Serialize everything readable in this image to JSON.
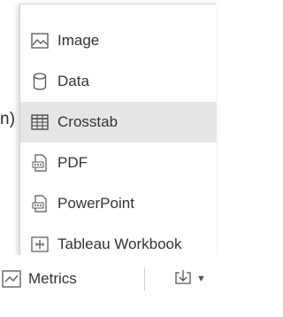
{
  "background_fragment": "n)",
  "download_menu": {
    "items": [
      {
        "label": "Image",
        "icon": "image-icon"
      },
      {
        "label": "Data",
        "icon": "database-icon"
      },
      {
        "label": "Crosstab",
        "icon": "table-grid-icon"
      },
      {
        "label": "PDF",
        "icon": "pdf-file-icon"
      },
      {
        "label": "PowerPoint",
        "icon": "ppt-file-icon"
      },
      {
        "label": "Tableau Workbook",
        "icon": "workbook-file-icon"
      }
    ],
    "highlighted_index": 2,
    "highlight_color": "#e6e6e6"
  },
  "toolbar": {
    "metrics_label": "Metrics",
    "metrics_icon": "metrics-chart-icon",
    "download_icon": "download-icon",
    "download_caret_icon": "caret-down-icon"
  }
}
